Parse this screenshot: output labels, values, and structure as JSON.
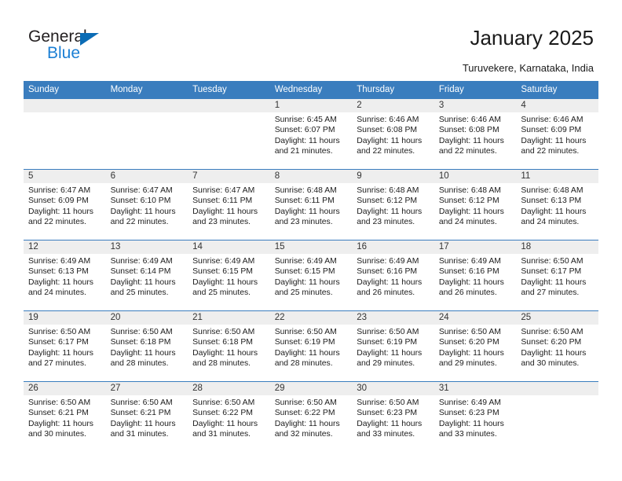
{
  "brand": {
    "name_top": "General",
    "name_bottom": "Blue",
    "triangle_color": "#0b6cb5",
    "blue_text_color": "#1b7fd4"
  },
  "header": {
    "title": "January 2025",
    "subtitle": "Turuvekere, Karnataka, India",
    "accent_color": "#3a7dbe"
  },
  "calendar": {
    "weekday_headers": [
      "Sunday",
      "Monday",
      "Tuesday",
      "Wednesday",
      "Thursday",
      "Friday",
      "Saturday"
    ],
    "weeks": [
      [
        {
          "day": "",
          "lines": []
        },
        {
          "day": "",
          "lines": []
        },
        {
          "day": "",
          "lines": []
        },
        {
          "day": "1",
          "lines": [
            "Sunrise: 6:45 AM",
            "Sunset: 6:07 PM",
            "Daylight: 11 hours",
            "and 21 minutes."
          ]
        },
        {
          "day": "2",
          "lines": [
            "Sunrise: 6:46 AM",
            "Sunset: 6:08 PM",
            "Daylight: 11 hours",
            "and 22 minutes."
          ]
        },
        {
          "day": "3",
          "lines": [
            "Sunrise: 6:46 AM",
            "Sunset: 6:08 PM",
            "Daylight: 11 hours",
            "and 22 minutes."
          ]
        },
        {
          "day": "4",
          "lines": [
            "Sunrise: 6:46 AM",
            "Sunset: 6:09 PM",
            "Daylight: 11 hours",
            "and 22 minutes."
          ]
        }
      ],
      [
        {
          "day": "5",
          "lines": [
            "Sunrise: 6:47 AM",
            "Sunset: 6:09 PM",
            "Daylight: 11 hours",
            "and 22 minutes."
          ]
        },
        {
          "day": "6",
          "lines": [
            "Sunrise: 6:47 AM",
            "Sunset: 6:10 PM",
            "Daylight: 11 hours",
            "and 22 minutes."
          ]
        },
        {
          "day": "7",
          "lines": [
            "Sunrise: 6:47 AM",
            "Sunset: 6:11 PM",
            "Daylight: 11 hours",
            "and 23 minutes."
          ]
        },
        {
          "day": "8",
          "lines": [
            "Sunrise: 6:48 AM",
            "Sunset: 6:11 PM",
            "Daylight: 11 hours",
            "and 23 minutes."
          ]
        },
        {
          "day": "9",
          "lines": [
            "Sunrise: 6:48 AM",
            "Sunset: 6:12 PM",
            "Daylight: 11 hours",
            "and 23 minutes."
          ]
        },
        {
          "day": "10",
          "lines": [
            "Sunrise: 6:48 AM",
            "Sunset: 6:12 PM",
            "Daylight: 11 hours",
            "and 24 minutes."
          ]
        },
        {
          "day": "11",
          "lines": [
            "Sunrise: 6:48 AM",
            "Sunset: 6:13 PM",
            "Daylight: 11 hours",
            "and 24 minutes."
          ]
        }
      ],
      [
        {
          "day": "12",
          "lines": [
            "Sunrise: 6:49 AM",
            "Sunset: 6:13 PM",
            "Daylight: 11 hours",
            "and 24 minutes."
          ]
        },
        {
          "day": "13",
          "lines": [
            "Sunrise: 6:49 AM",
            "Sunset: 6:14 PM",
            "Daylight: 11 hours",
            "and 25 minutes."
          ]
        },
        {
          "day": "14",
          "lines": [
            "Sunrise: 6:49 AM",
            "Sunset: 6:15 PM",
            "Daylight: 11 hours",
            "and 25 minutes."
          ]
        },
        {
          "day": "15",
          "lines": [
            "Sunrise: 6:49 AM",
            "Sunset: 6:15 PM",
            "Daylight: 11 hours",
            "and 25 minutes."
          ]
        },
        {
          "day": "16",
          "lines": [
            "Sunrise: 6:49 AM",
            "Sunset: 6:16 PM",
            "Daylight: 11 hours",
            "and 26 minutes."
          ]
        },
        {
          "day": "17",
          "lines": [
            "Sunrise: 6:49 AM",
            "Sunset: 6:16 PM",
            "Daylight: 11 hours",
            "and 26 minutes."
          ]
        },
        {
          "day": "18",
          "lines": [
            "Sunrise: 6:50 AM",
            "Sunset: 6:17 PM",
            "Daylight: 11 hours",
            "and 27 minutes."
          ]
        }
      ],
      [
        {
          "day": "19",
          "lines": [
            "Sunrise: 6:50 AM",
            "Sunset: 6:17 PM",
            "Daylight: 11 hours",
            "and 27 minutes."
          ]
        },
        {
          "day": "20",
          "lines": [
            "Sunrise: 6:50 AM",
            "Sunset: 6:18 PM",
            "Daylight: 11 hours",
            "and 28 minutes."
          ]
        },
        {
          "day": "21",
          "lines": [
            "Sunrise: 6:50 AM",
            "Sunset: 6:18 PM",
            "Daylight: 11 hours",
            "and 28 minutes."
          ]
        },
        {
          "day": "22",
          "lines": [
            "Sunrise: 6:50 AM",
            "Sunset: 6:19 PM",
            "Daylight: 11 hours",
            "and 28 minutes."
          ]
        },
        {
          "day": "23",
          "lines": [
            "Sunrise: 6:50 AM",
            "Sunset: 6:19 PM",
            "Daylight: 11 hours",
            "and 29 minutes."
          ]
        },
        {
          "day": "24",
          "lines": [
            "Sunrise: 6:50 AM",
            "Sunset: 6:20 PM",
            "Daylight: 11 hours",
            "and 29 minutes."
          ]
        },
        {
          "day": "25",
          "lines": [
            "Sunrise: 6:50 AM",
            "Sunset: 6:20 PM",
            "Daylight: 11 hours",
            "and 30 minutes."
          ]
        }
      ],
      [
        {
          "day": "26",
          "lines": [
            "Sunrise: 6:50 AM",
            "Sunset: 6:21 PM",
            "Daylight: 11 hours",
            "and 30 minutes."
          ]
        },
        {
          "day": "27",
          "lines": [
            "Sunrise: 6:50 AM",
            "Sunset: 6:21 PM",
            "Daylight: 11 hours",
            "and 31 minutes."
          ]
        },
        {
          "day": "28",
          "lines": [
            "Sunrise: 6:50 AM",
            "Sunset: 6:22 PM",
            "Daylight: 11 hours",
            "and 31 minutes."
          ]
        },
        {
          "day": "29",
          "lines": [
            "Sunrise: 6:50 AM",
            "Sunset: 6:22 PM",
            "Daylight: 11 hours",
            "and 32 minutes."
          ]
        },
        {
          "day": "30",
          "lines": [
            "Sunrise: 6:50 AM",
            "Sunset: 6:23 PM",
            "Daylight: 11 hours",
            "and 33 minutes."
          ]
        },
        {
          "day": "31",
          "lines": [
            "Sunrise: 6:49 AM",
            "Sunset: 6:23 PM",
            "Daylight: 11 hours",
            "and 33 minutes."
          ]
        },
        {
          "day": "",
          "lines": []
        }
      ]
    ]
  }
}
